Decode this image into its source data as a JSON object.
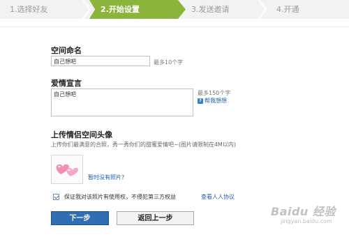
{
  "stepper": {
    "steps": [
      "1.选择好友",
      "2.开始设置",
      "3.发送邀请",
      "4.开通"
    ],
    "active_index": 1
  },
  "form": {
    "space_name": {
      "label": "空间命名",
      "value": "自己想吧",
      "hint": "最多10个字"
    },
    "declaration": {
      "label": "爱情宣言",
      "value": "自己想吧",
      "hint": "最多150个字",
      "help_link": "帮我想想"
    },
    "avatar": {
      "title": "上传情侣空间头像",
      "description": "上传你们最满意的合照，秀一秀你们的甜蜜爱情吧~(图片请限制在4M以内)",
      "no_photo_link": "暂时没有照片?"
    },
    "agreement": {
      "checked": true,
      "text": "保证我对该照片有使用权，不侵犯第三方权益",
      "link": "查看人人协议"
    }
  },
  "buttons": {
    "next": "下一步",
    "back": "返回上一步"
  },
  "watermark": {
    "logo": "Baidu 经验",
    "url": "jingyan.baidu.com"
  },
  "colors": {
    "active_step": "#8bb43a",
    "primary_button": "#2f6db5",
    "link": "#1f5ea8"
  }
}
